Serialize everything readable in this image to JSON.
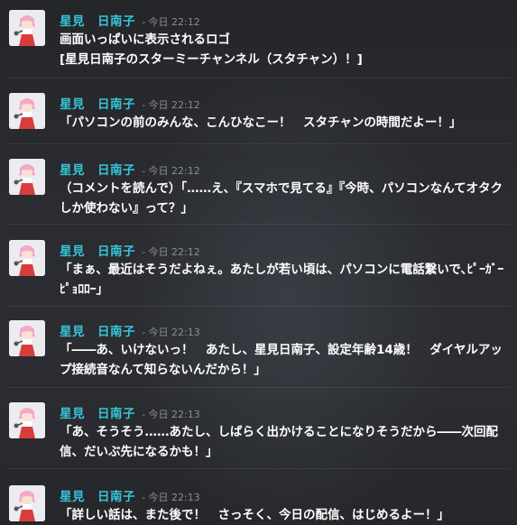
{
  "messages": [
    {
      "author": "星見　日南子",
      "timestamp": "- 今日 22:12",
      "text": "画面いっぱいに表示されるロゴ\n[星見日南子のスターミーチャンネル（スタチャン）！]"
    },
    {
      "author": "星見　日南子",
      "timestamp": "- 今日 22:12",
      "text": "「パソコンの前のみんな、こんひなこー！　スタチャンの時間だよー！」"
    },
    {
      "author": "星見　日南子",
      "timestamp": "- 今日 22:12",
      "text": "（コメントを読んで）「……え、『スマホで見てる』『今時、パソコンなんてオタクしか使わない』って？」"
    },
    {
      "author": "星見　日南子",
      "timestamp": "- 今日 22:12",
      "text": "「まぁ、最近はそうだよねぇ。あたしが若い頃は、パソコンに電話繋いで､ﾋﾟｰｶﾞｰﾋﾟｮﾛﾛｰ」"
    },
    {
      "author": "星見　日南子",
      "timestamp": "- 今日 22:13",
      "text": "「――あ、いけないっ！　あたし、星見日南子、設定年齢14歳！　ダイヤルアップ接続音なんて知らないんだから！」"
    },
    {
      "author": "星見　日南子",
      "timestamp": "- 今日 22:13",
      "text": "「あ、そうそう……あたし、しばらく出かけることになりそうだから――次回配信、だいぶ先になるかも！」"
    },
    {
      "author": "星見　日南子",
      "timestamp": "- 今日 22:13",
      "text": "「詳しい話は、また後で！　さっそく、今日の配信、はじめるよー！」"
    }
  ]
}
